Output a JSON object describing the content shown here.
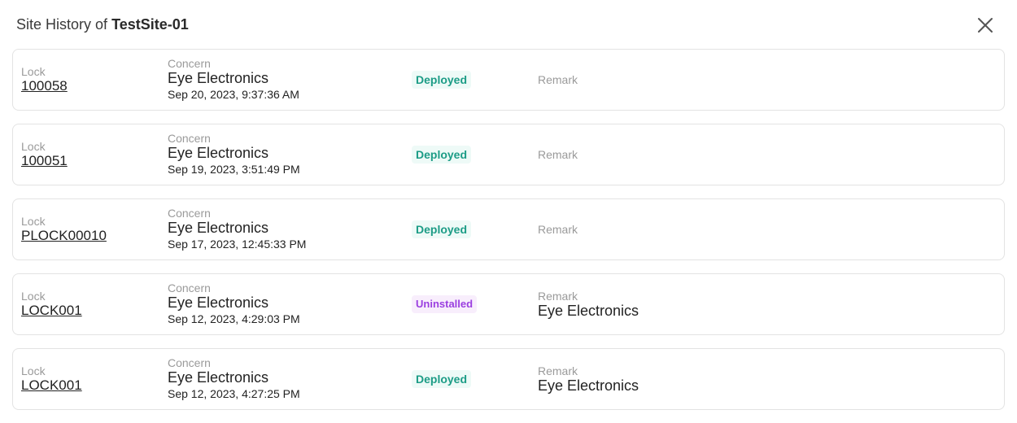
{
  "header": {
    "prefix": "Site History of",
    "site_name": "TestSite-01"
  },
  "labels": {
    "lock": "Lock",
    "concern": "Concern",
    "remark": "Remark"
  },
  "colors": {
    "deployed_text": "#1c9c86",
    "deployed_bg": "#eefaf7",
    "uninstalled_text": "#9b3fe0",
    "uninstalled_bg": "#f8eefc"
  },
  "icons": {
    "close": "close-icon"
  },
  "history": [
    {
      "lock": "100058",
      "concern": "Eye Electronics",
      "date": "Sep 20, 2023, 9:37:36 AM",
      "status": "Deployed",
      "remark": ""
    },
    {
      "lock": "100051",
      "concern": "Eye Electronics",
      "date": "Sep 19, 2023, 3:51:49 PM",
      "status": "Deployed",
      "remark": ""
    },
    {
      "lock": "PLOCK00010",
      "concern": "Eye Electronics",
      "date": "Sep 17, 2023, 12:45:33 PM",
      "status": "Deployed",
      "remark": ""
    },
    {
      "lock": "LOCK001",
      "concern": "Eye Electronics",
      "date": "Sep 12, 2023, 4:29:03 PM",
      "status": "Uninstalled",
      "remark": "Eye Electronics"
    },
    {
      "lock": "LOCK001",
      "concern": "Eye Electronics",
      "date": "Sep 12, 2023, 4:27:25 PM",
      "status": "Deployed",
      "remark": "Eye Electronics"
    }
  ]
}
